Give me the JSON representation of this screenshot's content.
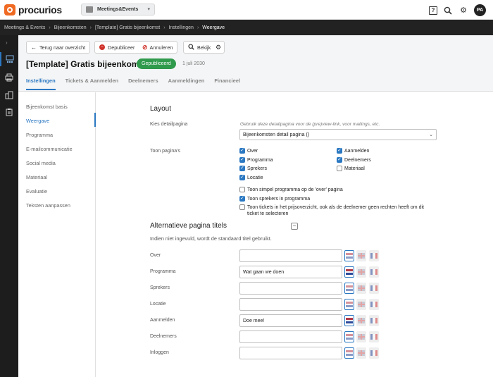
{
  "app": {
    "name": "procurios",
    "module": "Meetings&Events",
    "user_initials": "PA"
  },
  "breadcrumb": [
    "Meetings & Events",
    "Bijeenkomsten",
    "[Template] Gratis bijeenkomst",
    "Instellingen",
    "Weergave"
  ],
  "toolbar": {
    "back": "Terug naar overzicht",
    "depublish": "Depubliceer",
    "cancel": "Annuleren",
    "view": "Bekijk"
  },
  "page": {
    "title": "[Template] Gratis bijeenkomst",
    "status": "Gepubliceerd",
    "date": "1 juli 2030"
  },
  "tabs": [
    "Instellingen",
    "Tickets & Aanmelden",
    "Deelnemers",
    "Aanmeldingen",
    "Financieel"
  ],
  "active_tab": "Instellingen",
  "sidenav": [
    "Bijeenkomst basis",
    "Weergave",
    "Programma",
    "E-mailcommunicatie",
    "Social media",
    "Materiaal",
    "Evaluatie",
    "Teksten aanpassen"
  ],
  "active_sidenav": "Weergave",
  "layout": {
    "title": "Layout",
    "detail_label": "Kies detailpagina",
    "detail_hint": "Gebruik deze detailpagina voor de (pre)view-link, voor mailings, etc.",
    "detail_value": "Bijeenkomsten detail pagina ()",
    "pages_label": "Toon pagina's",
    "pages": [
      {
        "label": "Over",
        "checked": true
      },
      {
        "label": "Programma",
        "checked": true
      },
      {
        "label": "Sprekers",
        "checked": true
      },
      {
        "label": "Locatie",
        "checked": true
      },
      {
        "label": "Aanmelden",
        "checked": true
      },
      {
        "label": "Deelnemers",
        "checked": true
      },
      {
        "label": "Materiaal",
        "checked": false
      }
    ],
    "options": [
      {
        "label": "Toon simpel programma op de 'over' pagina",
        "checked": false
      },
      {
        "label": "Toon sprekers in programma",
        "checked": true
      },
      {
        "label": "Toon tickets in het prijsoverzicht, ook als de deelnemer geen rechten heeft om dit ticket te selecteren",
        "checked": false
      }
    ]
  },
  "alt_titles": {
    "title": "Alternatieve pagina titels",
    "hint": "Indien niet ingevuld, wordt de standaard titel gebruikt.",
    "rows": [
      {
        "label": "Over",
        "value": ""
      },
      {
        "label": "Programma",
        "value": "Wat gaan we doen"
      },
      {
        "label": "Sprekers",
        "value": ""
      },
      {
        "label": "Locatie",
        "value": ""
      },
      {
        "label": "Aanmelden",
        "value": "Doe mee!"
      },
      {
        "label": "Deelnemers",
        "value": ""
      },
      {
        "label": "Inloggen",
        "value": ""
      }
    ]
  },
  "colors": {
    "accent": "#2b78c2",
    "published": "#2f9a4c",
    "brand": "#f06a23",
    "danger": "#d0342c"
  }
}
